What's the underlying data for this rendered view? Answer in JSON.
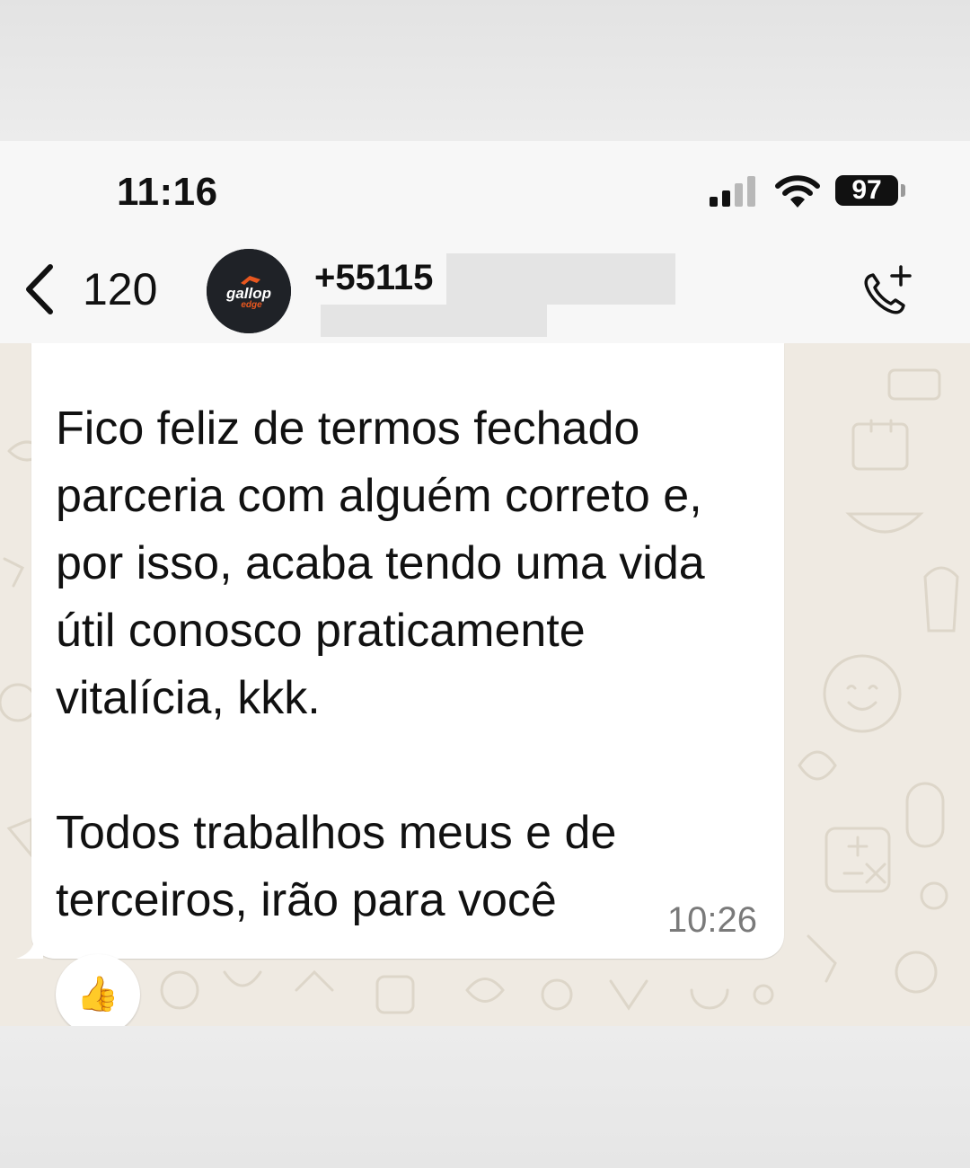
{
  "status_bar": {
    "time": "11:16",
    "battery": "97"
  },
  "header": {
    "back_count": "120",
    "avatar_brand_line1": "gallop",
    "avatar_brand_line2": "edge",
    "contact_number": "+55115"
  },
  "message": {
    "text": "Fico feliz de termos fechado\nparceria com alguém correto e,\npor isso, acaba tendo uma vida\nútil conosco praticamente\nvitalícia, kkk.\n\nTodos trabalhos meus e de\nterceiros, irão para você",
    "time": "10:26",
    "reaction": "👍"
  },
  "colors": {
    "chat_background": "#efeae2",
    "bubble": "#ffffff",
    "header_background": "#f7f7f7",
    "avatar_accent": "#e8571f"
  }
}
